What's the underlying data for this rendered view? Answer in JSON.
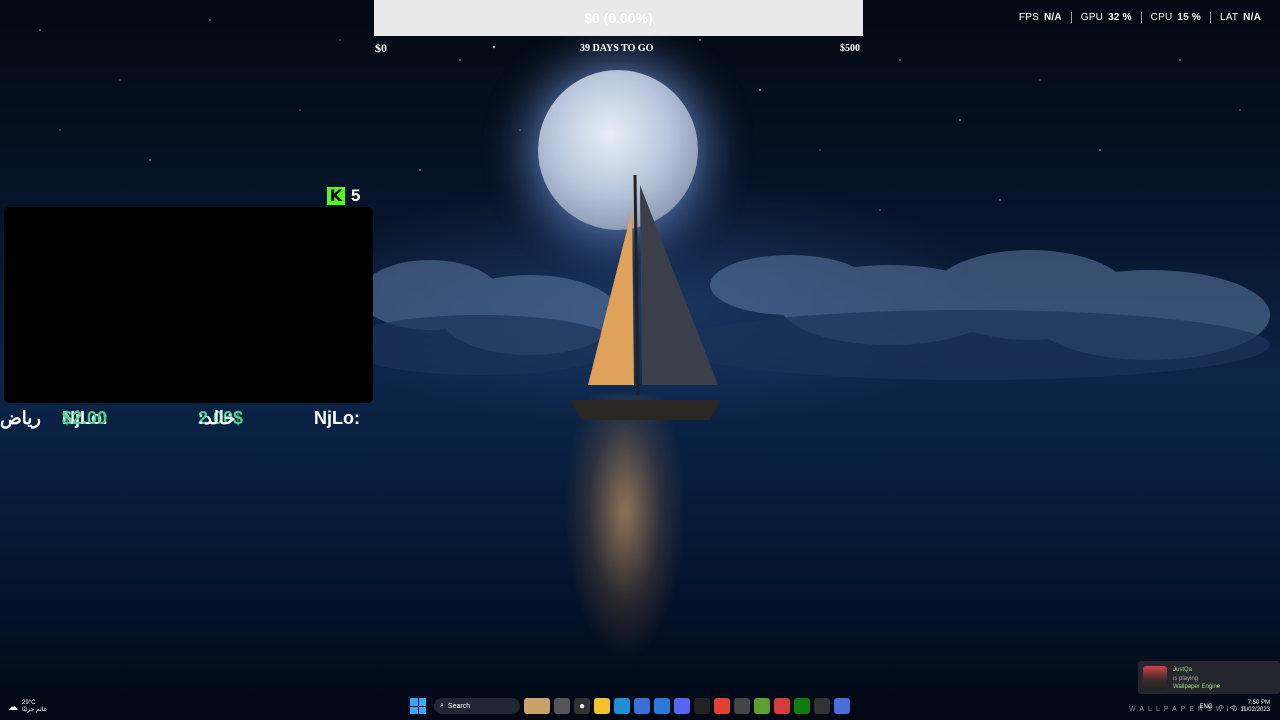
{
  "goal_bar": {
    "progress_text": "$0 (0.00%)",
    "progress_fraction": 0.0,
    "min_label": "$0",
    "max_label": "$500",
    "days_label": "39 DAYS TO GO"
  },
  "perf_overlay": {
    "fps_label": "FPS",
    "fps_value": "N/A",
    "gpu_label": "GPU",
    "gpu_value": "32 %",
    "cpu_label": "CPU",
    "cpu_value": "15 %",
    "lat_label": "LAT",
    "lat_value": "N/A"
  },
  "kick": {
    "logo": "K",
    "viewer_count": "5"
  },
  "ticker": {
    "items": [
      {
        "name": "رياض",
        "amount": ""
      },
      {
        "name": "NjLo:",
        "amount": "$2.00"
      },
      {
        "name": ":خالد",
        "amount": "2.00$"
      },
      {
        "name": "NjLo:",
        "amount": ""
      }
    ]
  },
  "notification": {
    "user": "JustQa",
    "status": "is playing",
    "game": "Wallpaper Engine"
  },
  "taskbar": {
    "weather_temp": "29°C",
    "weather_desc": "غائم جزئيًا",
    "search_placeholder": "Search",
    "clock_time": "7:50 PM",
    "clock_date": "11/02/2023",
    "language": "ENG"
  },
  "watermark": "WALLPAPERSWIDE",
  "colors": {
    "goal_bar_bg": "#e9e9ea",
    "kick_green": "#53fc18",
    "ticker_amount": "#4fd18b"
  }
}
